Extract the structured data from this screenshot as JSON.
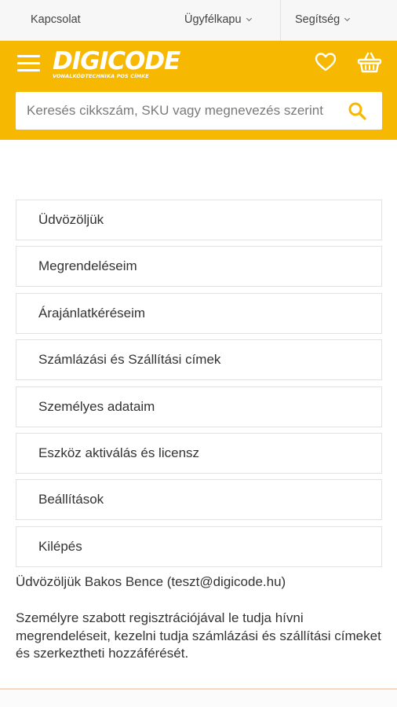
{
  "topbar": {
    "contact_label": "Kapcsolat",
    "portal_label": "Ügyfélkapu",
    "help_label": "Segítség"
  },
  "header": {
    "logo_text": "DIGICODE",
    "logo_tagline": "VONALKÓDTECHNIKA POS CÍMKE",
    "brand_color": "#f6b800",
    "icons": [
      "menu-icon",
      "heart-icon",
      "basket-icon",
      "search-icon"
    ]
  },
  "search": {
    "placeholder": "Keresés cikkszám, SKU vagy megnevezés szerint",
    "value": ""
  },
  "menu": {
    "items": [
      {
        "label": "Üdvözöljük"
      },
      {
        "label": "Megrendeléseim"
      },
      {
        "label": "Árajánlatkéréseim"
      },
      {
        "label": "Számlázási és Szállítási címek"
      },
      {
        "label": "Személyes adataim"
      },
      {
        "label": "Eszköz aktiválás és licensz"
      },
      {
        "label": "Beállítások"
      },
      {
        "label": "Kilépés"
      }
    ]
  },
  "account": {
    "welcome_text": "Üdvözöljük Bakos Bence (teszt@digicode.hu)",
    "description": "Személyre szabott regisztrációjával le tudja hívni megrendeléseit, kezelni tudja számlázási és szállítási címeket és szerkeztheti hozzáférését."
  }
}
